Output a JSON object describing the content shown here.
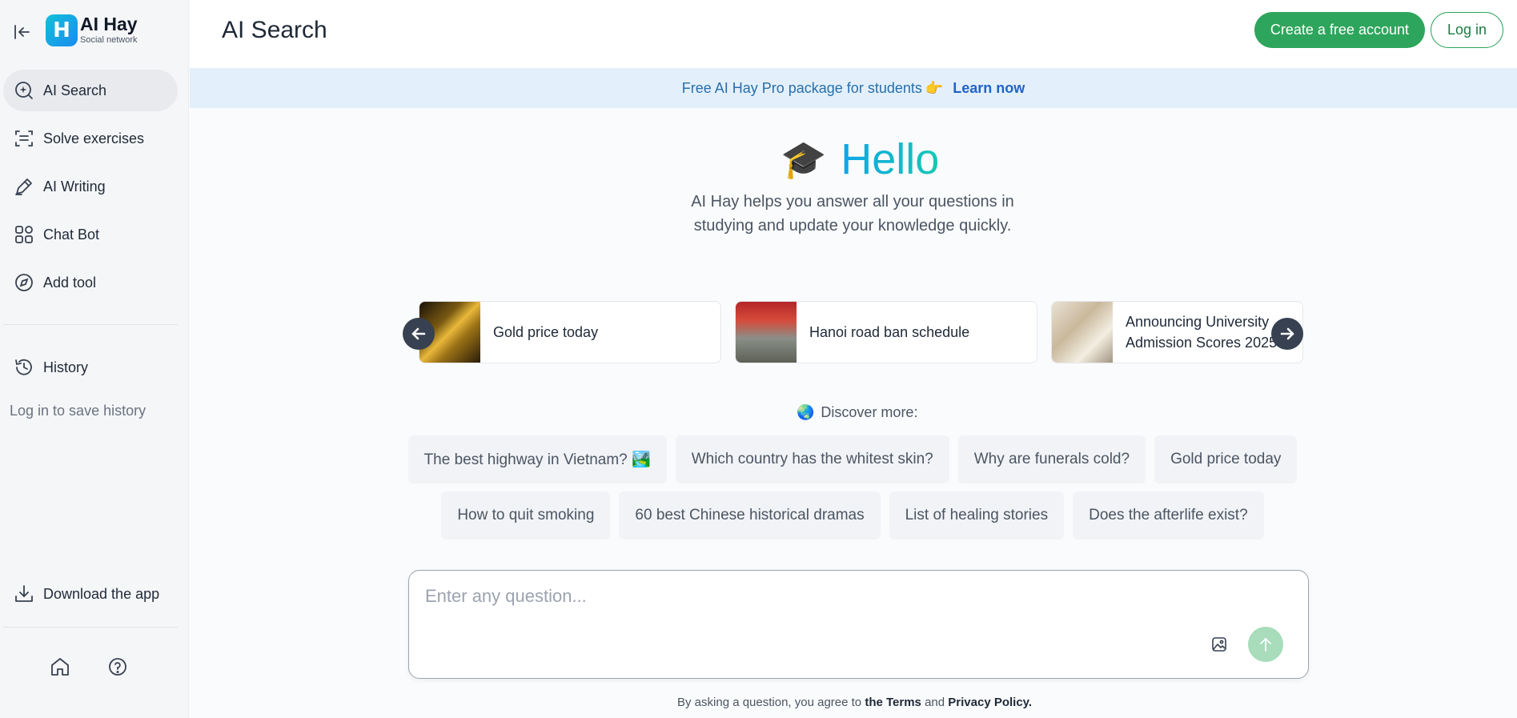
{
  "sidebar": {
    "logo": {
      "name": "AI Hay",
      "tagline": "Social network",
      "mark": "H"
    },
    "nav": [
      {
        "label": "AI Search",
        "icon": "search-sparkle-icon"
      },
      {
        "label": "Solve exercises",
        "icon": "scan-icon"
      },
      {
        "label": "AI Writing",
        "icon": "pen-icon"
      },
      {
        "label": "Chat Bot",
        "icon": "grid-icon"
      },
      {
        "label": "Add tool",
        "icon": "compass-icon"
      }
    ],
    "history_label": "History",
    "history_hint": "Log in to save history",
    "download_label": "Download the app"
  },
  "header": {
    "title": "AI Search",
    "create_account": "Create a free account",
    "login": "Log in"
  },
  "banner": {
    "text": "Free AI Hay Pro package for students",
    "emoji": "👉",
    "link": "Learn now"
  },
  "hero": {
    "emoji": "🎓",
    "title": "Hello",
    "subtitle": "AI Hay helps you answer all your questions in studying and update your knowledge quickly."
  },
  "trending": [
    {
      "label": "Gold price today"
    },
    {
      "label": "Hanoi road ban schedule"
    },
    {
      "label": "Announcing University Admission Scores 2025"
    }
  ],
  "discover": {
    "emoji": "🌏",
    "label": "Discover more:",
    "row1": [
      "The best highway in Vietnam? 🏞️",
      "Which country has the whitest skin?",
      "Why are funerals cold?",
      "Gold price today"
    ],
    "row2": [
      "How to quit smoking",
      "60 best Chinese historical dramas",
      "List of healing stories",
      "Does the afterlife exist?"
    ]
  },
  "ask": {
    "placeholder": "Enter any question..."
  },
  "footer": {
    "prefix": "By asking a question, you agree to",
    "terms": "the Terms",
    "and": "and",
    "privacy": "Privacy Policy."
  },
  "colors": {
    "accent_green": "#2ea55c",
    "banner_bg": "#e3f0fb",
    "link_blue": "#1f63c8"
  }
}
